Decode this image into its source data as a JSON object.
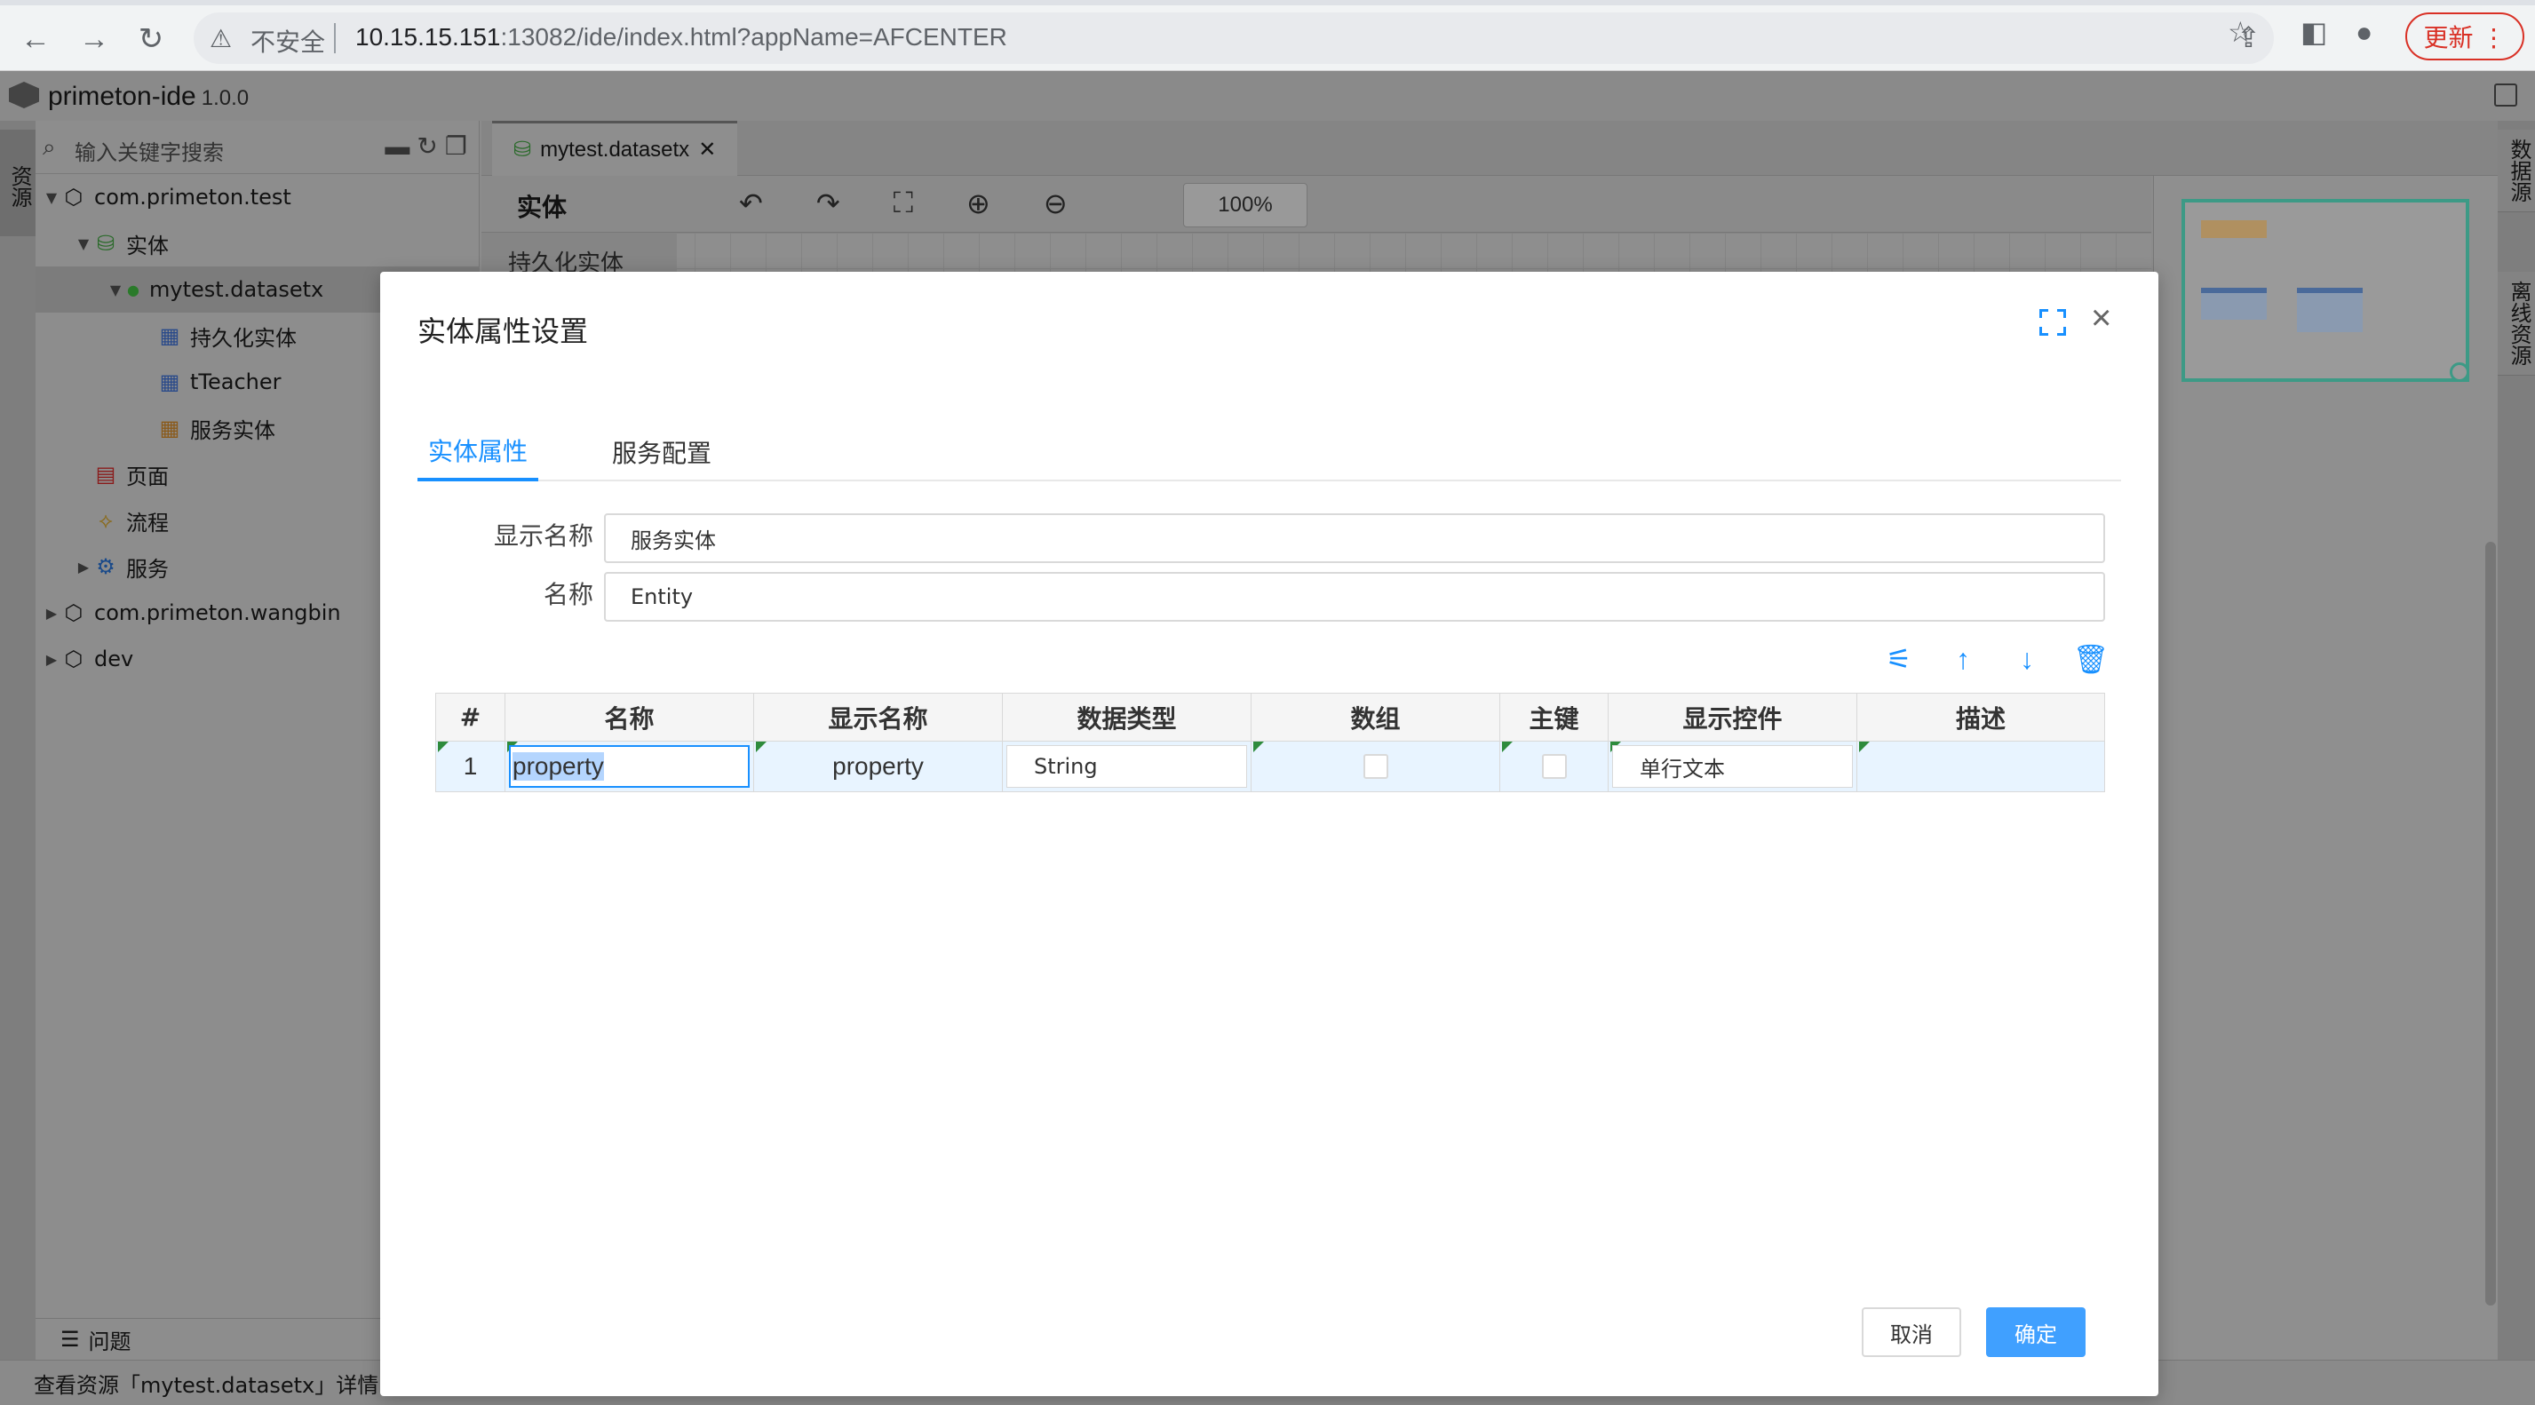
{
  "browser": {
    "nav_back": "←",
    "nav_forward": "→",
    "nav_reload": "↻",
    "security_label": "不安全",
    "url_host": "10.15.15.151",
    "url_path": ":13082/ide/index.html?appName=AFCENTER",
    "update_label": "更新 ⋮"
  },
  "ide": {
    "app_name": "primeton-ide",
    "version": "1.0.0",
    "left_strip_tab": "资源",
    "right_strip_tabs": [
      "数据源",
      "离线资源"
    ],
    "search_placeholder": "输入关键字搜索",
    "tree": [
      {
        "label": "com.primeton.test",
        "arrow": "▼",
        "icon": "package-icon"
      },
      {
        "label": "实体",
        "arrow": "▼",
        "icon": "database-icon"
      },
      {
        "label": "mytest.datasetx",
        "arrow": "▼",
        "icon": "dataset-dot-icon"
      },
      {
        "label": "持久化实体",
        "arrow": "",
        "icon": "table-icon"
      },
      {
        "label": "tTeacher",
        "arrow": "",
        "icon": "table-icon"
      },
      {
        "label": "服务实体",
        "arrow": "",
        "icon": "service-table-icon"
      },
      {
        "label": "页面",
        "arrow": "",
        "icon": "page-icon"
      },
      {
        "label": "流程",
        "arrow": "",
        "icon": "flow-icon"
      },
      {
        "label": "服务",
        "arrow": "▶",
        "icon": "gear-icon"
      },
      {
        "label": "com.primeton.wangbin",
        "arrow": "▶",
        "icon": "package-icon"
      },
      {
        "label": "dev",
        "arrow": "▶",
        "icon": "package-icon"
      }
    ],
    "problems_label": "问题",
    "status_text": "查看资源「mytest.datasetx」详情",
    "editor_tab": "mytest.datasetx",
    "canvas_label": "实体",
    "canvas_side_item": "持久化实体",
    "zoom": "100%"
  },
  "modal": {
    "title": "实体属性设置",
    "tabs": [
      "实体属性",
      "服务配置"
    ],
    "fields": [
      {
        "label": "显示名称",
        "value": "服务实体"
      },
      {
        "label": "名称",
        "value": "Entity"
      }
    ],
    "columns": [
      "#",
      "名称",
      "显示名称",
      "数据类型",
      "数组",
      "主键",
      "显示控件",
      "描述"
    ],
    "rows": [
      {
        "index": "1",
        "name": "property",
        "display_name": "property",
        "data_type": "String",
        "is_array": false,
        "is_primary_key": false,
        "control": "单行文本",
        "description": ""
      }
    ],
    "cancel_label": "取消",
    "ok_label": "确定"
  }
}
